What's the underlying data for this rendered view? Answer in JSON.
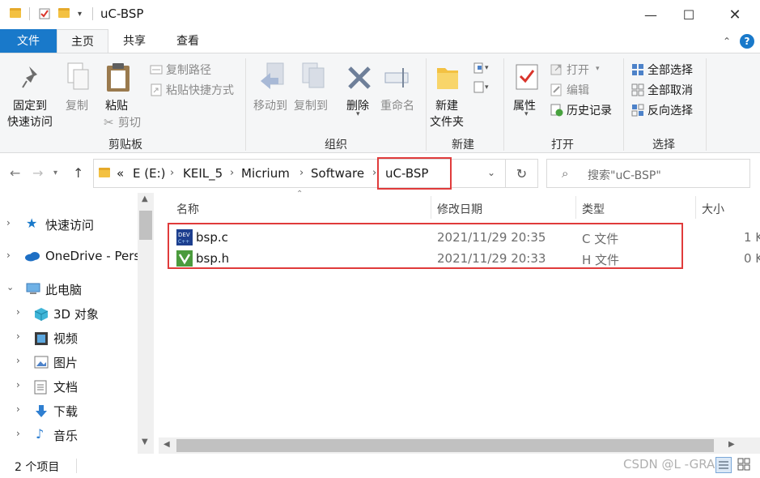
{
  "window": {
    "title": "uC-BSP"
  },
  "tabs": {
    "file": "文件",
    "home": "主页",
    "share": "共享",
    "view": "查看"
  },
  "ribbon": {
    "clipboard": {
      "pin_label_1": "固定到",
      "pin_label_2": "快速访问",
      "copy": "复制",
      "paste": "粘贴",
      "copy_path": "复制路径",
      "paste_shortcut": "粘贴快捷方式",
      "cut": "剪切",
      "group": "剪贴板"
    },
    "organize": {
      "move_to": "移动到",
      "copy_to": "复制到",
      "delete": "删除",
      "rename": "重命名",
      "group": "组织"
    },
    "new": {
      "new_folder_1": "新建",
      "new_folder_2": "文件夹",
      "group": "新建"
    },
    "open": {
      "properties": "属性",
      "open": "打开",
      "edit": "编辑",
      "history": "历史记录",
      "group": "打开"
    },
    "select": {
      "select_all": "全部选择",
      "select_none": "全部取消",
      "invert": "反向选择",
      "group": "选择"
    }
  },
  "address": {
    "overflow": "«",
    "crumbs": [
      "E (E:)",
      "KEIL_5",
      "Micrium",
      "Software",
      "uC-BSP"
    ],
    "search_placeholder": "搜索\"uC-BSP\""
  },
  "navpane": {
    "items": [
      {
        "label": "快速访问",
        "icon": "star-icon"
      },
      {
        "label": "OneDrive - Pers",
        "icon": "cloud-icon"
      },
      {
        "label": "此电脑",
        "icon": "computer-icon"
      },
      {
        "label": "3D 对象",
        "icon": "3d-objects-icon"
      },
      {
        "label": "视频",
        "icon": "video-icon"
      },
      {
        "label": "图片",
        "icon": "pictures-icon"
      },
      {
        "label": "文档",
        "icon": "documents-icon"
      },
      {
        "label": "下载",
        "icon": "download-icon"
      },
      {
        "label": "音乐",
        "icon": "music-icon"
      }
    ]
  },
  "filelist": {
    "columns": {
      "name": "名称",
      "date": "修改日期",
      "type": "类型",
      "size": "大小"
    },
    "rows": [
      {
        "name": "bsp.c",
        "date": "2021/11/29 20:35",
        "type": "C 文件",
        "size": "1 K"
      },
      {
        "name": "bsp.h",
        "date": "2021/11/29 20:33",
        "type": "H 文件",
        "size": "0 K"
      }
    ]
  },
  "status": {
    "count": "2 个项目"
  },
  "watermark": "CSDN @L -GRAZY",
  "colors": {
    "accent": "#1979ca",
    "highlight": "#e03b3b"
  }
}
